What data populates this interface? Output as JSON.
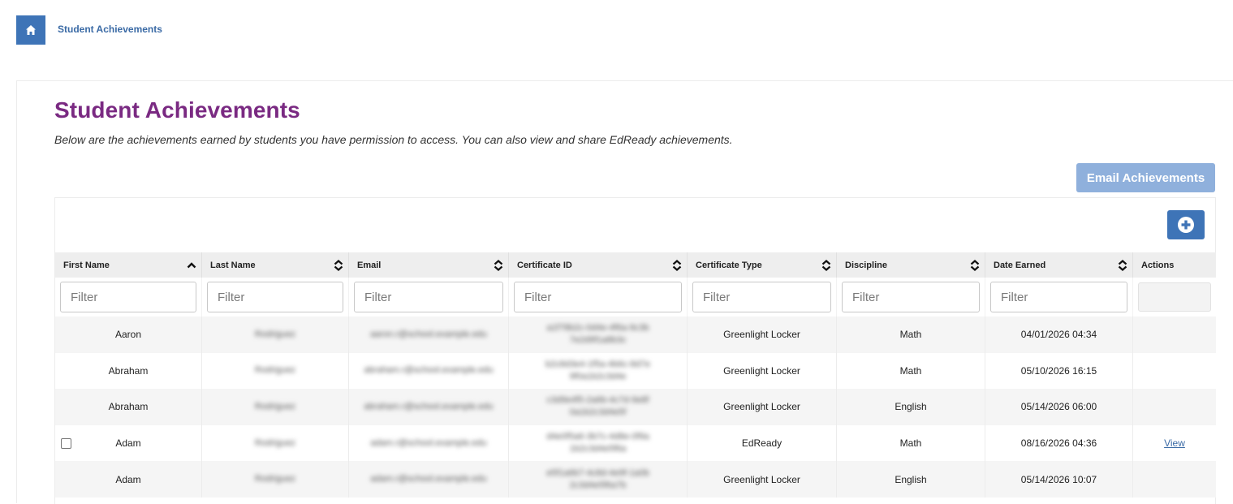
{
  "breadcrumb": {
    "current": "Student Achievements"
  },
  "page": {
    "title": "Student Achievements",
    "description": "Below are the achievements earned by students you have permission to access. You can also view and share EdReady achievements."
  },
  "toolbar": {
    "email_label": "Email Achievements"
  },
  "table": {
    "columns": [
      "First Name",
      "Last Name",
      "Email",
      "Certificate ID",
      "Certificate Type",
      "Discipline",
      "Date Earned",
      "Actions"
    ],
    "filter_placeholder": "Filter",
    "rows": [
      {
        "first": "Aaron",
        "last": "Rodriguez",
        "email": "aaron.r@school.example.edu",
        "cert_id_1": "a1f78b2c-0d4e-4f6a-9c3b",
        "cert_id_2": "7e2d9f1a8b3c",
        "type": "Greenlight Locker",
        "discipline": "Math",
        "date": "04/01/2026 04:34",
        "action": ""
      },
      {
        "first": "Abraham",
        "last": "Rodriguez",
        "email": "abraham.r@school.example.edu",
        "cert_id_1": "b2c8d3e4-1f5a-4b6c-8d7e",
        "cert_id_2": "9f0a1b2c3d4e",
        "type": "Greenlight Locker",
        "discipline": "Math",
        "date": "05/10/2026 16:15",
        "action": ""
      },
      {
        "first": "Abraham",
        "last": "Rodriguez",
        "email": "abraham.r@school.example.edu",
        "cert_id_1": "c3d9e4f5-2a6b-4c7d-9e8f",
        "cert_id_2": "0a1b2c3d4e5f",
        "type": "Greenlight Locker",
        "discipline": "English",
        "date": "05/14/2026 06:00",
        "action": ""
      },
      {
        "first": "Adam",
        "last": "Rodriguez",
        "email": "adam.r@school.example.edu",
        "cert_id_1": "d4e0f5a6-3b7c-4d8e-0f9a",
        "cert_id_2": "1b2c3d4e5f6a",
        "type": "EdReady",
        "discipline": "Math",
        "date": "08/16/2026 04:36",
        "action": "View"
      },
      {
        "first": "Adam",
        "last": "Rodriguez",
        "email": "adam.r@school.example.edu",
        "cert_id_1": "e5f1a6b7-4c8d-4e9f-1a0b",
        "cert_id_2": "2c3d4e5f6a7b",
        "type": "Greenlight Locker",
        "discipline": "English",
        "date": "05/14/2026 10:07",
        "action": ""
      }
    ]
  }
}
